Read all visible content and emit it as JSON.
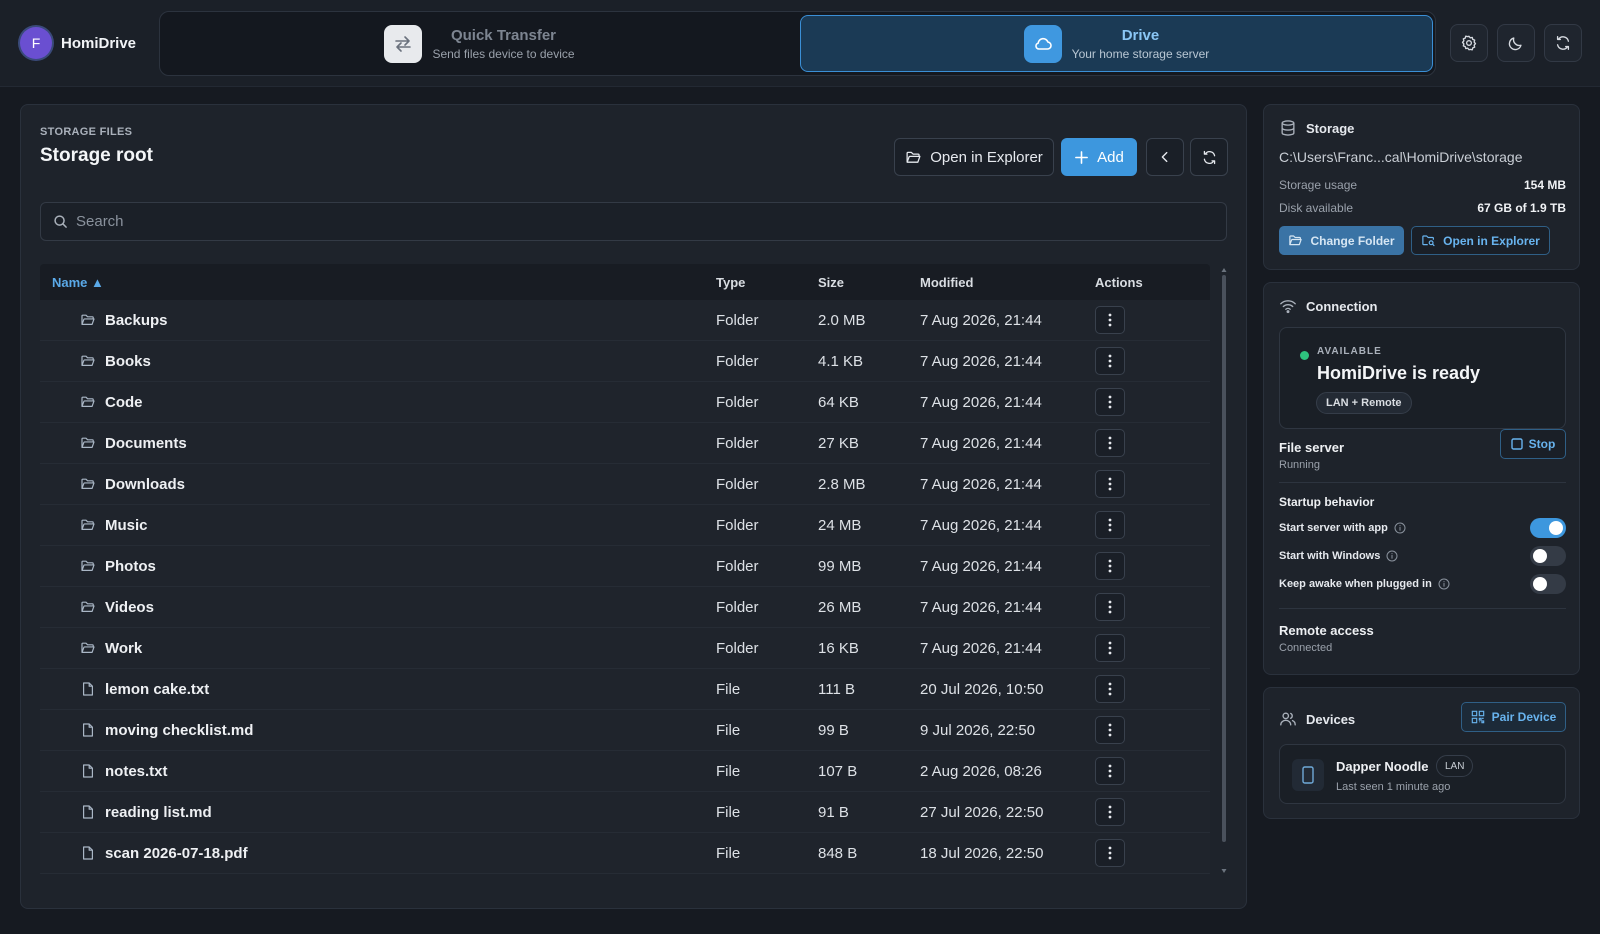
{
  "app": {
    "avatar_letter": "F",
    "name": "HomiDrive"
  },
  "modes": {
    "quick": {
      "title": "Quick Transfer",
      "subtitle": "Send files device to device"
    },
    "drive": {
      "title": "Drive",
      "subtitle": "Your home storage server"
    }
  },
  "header_icons": [
    "gear-icon",
    "moon-icon",
    "refresh-icon"
  ],
  "main": {
    "eyebrow": "STORAGE FILES",
    "title": "Storage root",
    "open_explorer_label": "Open in Explorer",
    "add_label": "Add",
    "search_placeholder": "Search",
    "columns": {
      "name": "Name ▲",
      "type": "Type",
      "size": "Size",
      "modified": "Modified",
      "actions": "Actions"
    },
    "rows": [
      {
        "name": "Backups",
        "type": "Folder",
        "size": "2.0 MB",
        "modified": "7 Aug 2026, 21:44",
        "icon": "folder-icon"
      },
      {
        "name": "Books",
        "type": "Folder",
        "size": "4.1 KB",
        "modified": "7 Aug 2026, 21:44",
        "icon": "folder-icon"
      },
      {
        "name": "Code",
        "type": "Folder",
        "size": "64 KB",
        "modified": "7 Aug 2026, 21:44",
        "icon": "folder-icon"
      },
      {
        "name": "Documents",
        "type": "Folder",
        "size": "27 KB",
        "modified": "7 Aug 2026, 21:44",
        "icon": "folder-icon"
      },
      {
        "name": "Downloads",
        "type": "Folder",
        "size": "2.8 MB",
        "modified": "7 Aug 2026, 21:44",
        "icon": "folder-icon"
      },
      {
        "name": "Music",
        "type": "Folder",
        "size": "24 MB",
        "modified": "7 Aug 2026, 21:44",
        "icon": "folder-icon"
      },
      {
        "name": "Photos",
        "type": "Folder",
        "size": "99 MB",
        "modified": "7 Aug 2026, 21:44",
        "icon": "folder-icon"
      },
      {
        "name": "Videos",
        "type": "Folder",
        "size": "26 MB",
        "modified": "7 Aug 2026, 21:44",
        "icon": "folder-icon"
      },
      {
        "name": "Work",
        "type": "Folder",
        "size": "16 KB",
        "modified": "7 Aug 2026, 21:44",
        "icon": "folder-icon"
      },
      {
        "name": "lemon cake.txt",
        "type": "File",
        "size": "111 B",
        "modified": "20 Jul 2026, 10:50",
        "icon": "file-icon"
      },
      {
        "name": "moving checklist.md",
        "type": "File",
        "size": "99 B",
        "modified": "9 Jul 2026, 22:50",
        "icon": "file-icon"
      },
      {
        "name": "notes.txt",
        "type": "File",
        "size": "107 B",
        "modified": "2 Aug 2026, 08:26",
        "icon": "file-icon"
      },
      {
        "name": "reading list.md",
        "type": "File",
        "size": "91 B",
        "modified": "27 Jul 2026, 22:50",
        "icon": "file-icon"
      },
      {
        "name": "scan 2026-07-18.pdf",
        "type": "File",
        "size": "848 B",
        "modified": "18 Jul 2026, 22:50",
        "icon": "file-icon"
      }
    ]
  },
  "storage": {
    "title": "Storage",
    "path": "C:\\Users\\Franc...cal\\HomiDrive\\storage",
    "usage_label": "Storage usage",
    "usage_value": "154 MB",
    "disk_label": "Disk available",
    "disk_value": "67 GB of 1.9 TB",
    "change_folder_label": "Change Folder",
    "open_explorer_label": "Open in Explorer"
  },
  "connection": {
    "title": "Connection",
    "status_eyebrow": "AVAILABLE",
    "status_title": "HomiDrive is ready",
    "mode_chip": "LAN + Remote",
    "file_server_label": "File server",
    "file_server_status": "Running",
    "stop_label": "Stop",
    "startup_label": "Startup behavior",
    "toggles": [
      {
        "label": "Start server with app",
        "on": true
      },
      {
        "label": "Start with Windows",
        "on": false
      },
      {
        "label": "Keep awake when plugged in",
        "on": false
      }
    ],
    "remote_label": "Remote access",
    "remote_status": "Connected"
  },
  "devices": {
    "title": "Devices",
    "pair_label": "Pair Device",
    "items": [
      {
        "name": "Dapper Noodle",
        "chip": "LAN",
        "last_seen": "Last seen 1 minute ago"
      }
    ]
  },
  "colors": {
    "accent": "#3d97de",
    "background": "#161a21",
    "panel": "#1e232b",
    "success": "#2ec27e"
  }
}
